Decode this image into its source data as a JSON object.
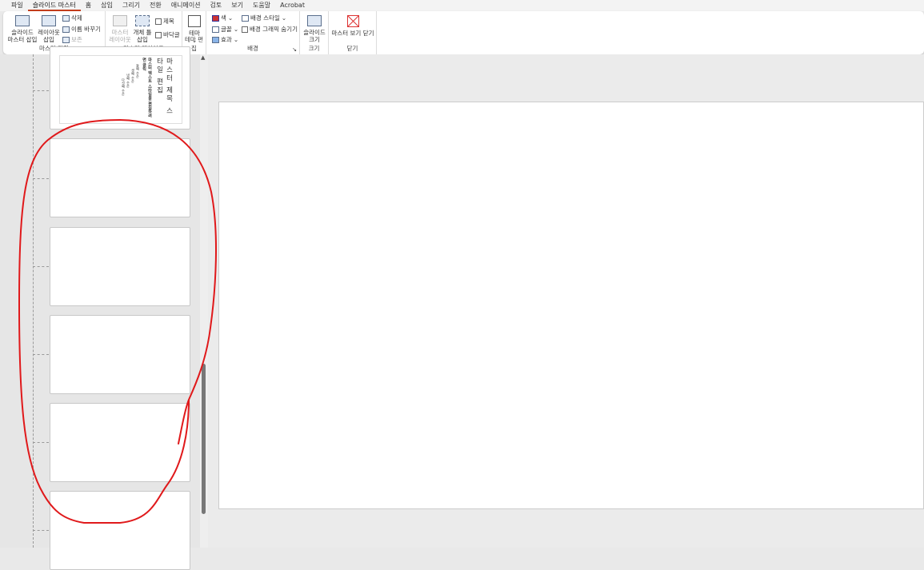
{
  "menu": [
    "파일",
    "슬라이드 마스터",
    "홈",
    "삽입",
    "그리기",
    "전환",
    "애니메이션",
    "검토",
    "보기",
    "도움말",
    "Acrobat"
  ],
  "ribbon": {
    "master_edit": {
      "insert_master": "슬라이드\n마스터 삽입",
      "insert_layout": "레이아웃\n삽입",
      "delete": "삭제",
      "rename": "이름 바꾸기",
      "preserve": "보존",
      "label": "마스터 편집"
    },
    "master_layout": {
      "master_layout": "마스터\n레이아웃",
      "insert_placeholder": "개체 틀\n삽입",
      "title": "제목",
      "footer": "바닥글",
      "label": "마스터 레이아웃"
    },
    "theme_edit": {
      "theme": "테마",
      "label": "테마 편집"
    },
    "background": {
      "colors": "색",
      "fonts": "글꼴",
      "effects": "효과",
      "bg_styles": "배경 스타일",
      "hide_bg": "배경 그래픽 숨기기",
      "label": "배경"
    },
    "size": {
      "slide_size": "슬라이드\n크기",
      "label": "크기"
    },
    "close": {
      "close_master": "마스터 보기 닫기",
      "label": "닫기"
    }
  },
  "thumb1": {
    "title": "마스터 제목 스타일 편집",
    "body": "마스터 텍스트 스타일을 편집하려면 클릭",
    "levels": [
      "둘째 수준",
      "셋째 수준",
      "넷째 수준",
      "다섯째 수준"
    ]
  },
  "annotation_color": "#e0191b"
}
